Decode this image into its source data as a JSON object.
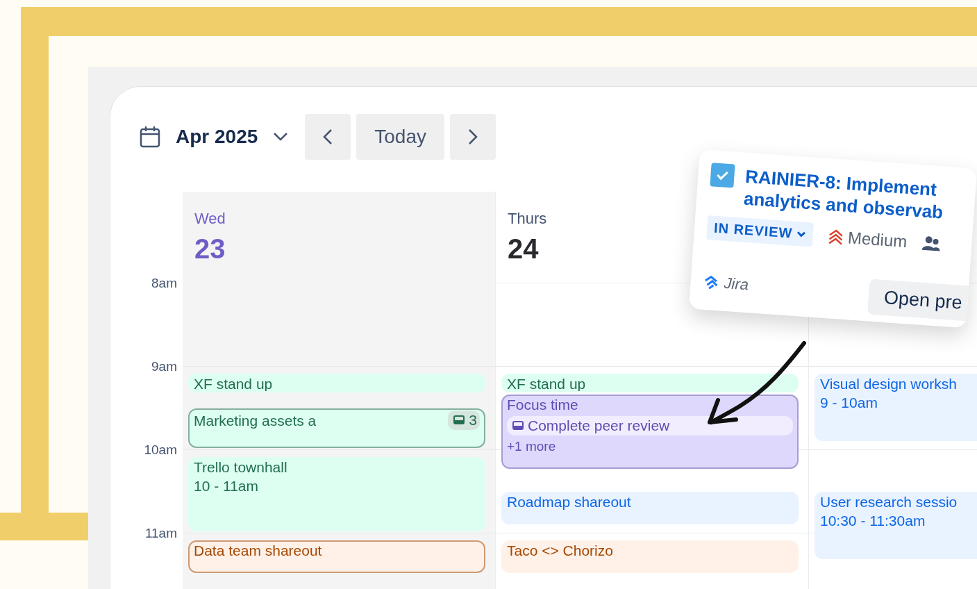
{
  "toolbar": {
    "month": "Apr 2025",
    "today_button": "Today"
  },
  "time_labels": [
    "8am",
    "9am",
    "10am",
    "11am"
  ],
  "days": [
    {
      "weekday": "Wed",
      "date": "23",
      "selected": true,
      "events": [
        {
          "title": "XF stand up",
          "color": "#216e4e",
          "outlined": false
        },
        {
          "title": "Marketing assets a",
          "color": "#216e4e",
          "outlined": true,
          "badge": "3"
        },
        {
          "title": "Trello townhall",
          "time": "10 - 11am",
          "color": "#216e4e",
          "outlined": false
        },
        {
          "title": "Data team shareout",
          "color": "#a54800",
          "outlined": true
        }
      ]
    },
    {
      "weekday": "Thurs",
      "date": "24",
      "selected": false,
      "events": [
        {
          "title": "XF stand up",
          "color": "#216e4e",
          "outlined": false
        },
        {
          "title": "Focus time",
          "color": "#5e4db2",
          "outlined": true,
          "subitem": "Complete peer review",
          "more": "+1 more"
        },
        {
          "title": "Roadmap shareout",
          "color": "#0c66e4",
          "outlined": false
        },
        {
          "title": "Taco <> Chorizo",
          "color": "#a54800",
          "outlined": false
        }
      ]
    },
    {
      "events": [
        {
          "title": "Visual design worksh",
          "time": "9 - 10am",
          "color": "#0c66e4",
          "outlined": false
        },
        {
          "title": "User research sessio",
          "time": "10:30 - 11:30am",
          "color": "#0c66e4",
          "outlined": false
        }
      ]
    }
  ],
  "popover": {
    "checked": true,
    "title": "RAINIER-8: Implement analytics and observab",
    "status": "IN REVIEW",
    "priority": "Medium",
    "source": "Jira",
    "button": "Open pre"
  }
}
